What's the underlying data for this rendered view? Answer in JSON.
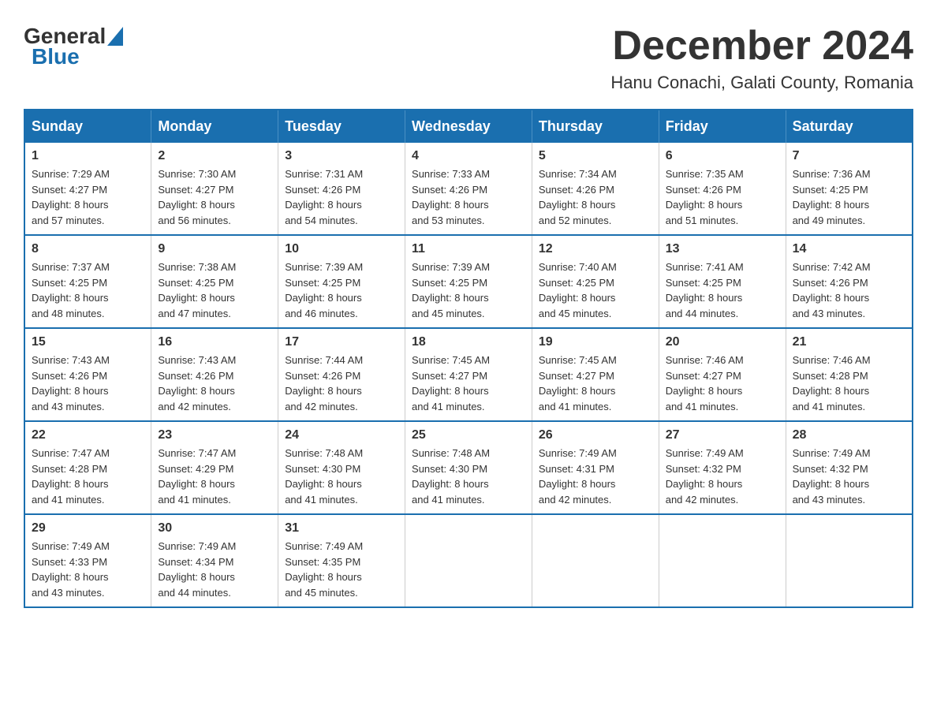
{
  "logo": {
    "general": "General",
    "blue": "Blue",
    "tagline": "Blue"
  },
  "title": {
    "month_year": "December 2024",
    "location": "Hanu Conachi, Galati County, Romania"
  },
  "weekdays": [
    "Sunday",
    "Monday",
    "Tuesday",
    "Wednesday",
    "Thursday",
    "Friday",
    "Saturday"
  ],
  "weeks": [
    [
      {
        "day": "1",
        "sunrise": "7:29 AM",
        "sunset": "4:27 PM",
        "daylight": "8 hours and 57 minutes."
      },
      {
        "day": "2",
        "sunrise": "7:30 AM",
        "sunset": "4:27 PM",
        "daylight": "8 hours and 56 minutes."
      },
      {
        "day": "3",
        "sunrise": "7:31 AM",
        "sunset": "4:26 PM",
        "daylight": "8 hours and 54 minutes."
      },
      {
        "day": "4",
        "sunrise": "7:33 AM",
        "sunset": "4:26 PM",
        "daylight": "8 hours and 53 minutes."
      },
      {
        "day": "5",
        "sunrise": "7:34 AM",
        "sunset": "4:26 PM",
        "daylight": "8 hours and 52 minutes."
      },
      {
        "day": "6",
        "sunrise": "7:35 AM",
        "sunset": "4:26 PM",
        "daylight": "8 hours and 51 minutes."
      },
      {
        "day": "7",
        "sunrise": "7:36 AM",
        "sunset": "4:25 PM",
        "daylight": "8 hours and 49 minutes."
      }
    ],
    [
      {
        "day": "8",
        "sunrise": "7:37 AM",
        "sunset": "4:25 PM",
        "daylight": "8 hours and 48 minutes."
      },
      {
        "day": "9",
        "sunrise": "7:38 AM",
        "sunset": "4:25 PM",
        "daylight": "8 hours and 47 minutes."
      },
      {
        "day": "10",
        "sunrise": "7:39 AM",
        "sunset": "4:25 PM",
        "daylight": "8 hours and 46 minutes."
      },
      {
        "day": "11",
        "sunrise": "7:39 AM",
        "sunset": "4:25 PM",
        "daylight": "8 hours and 45 minutes."
      },
      {
        "day": "12",
        "sunrise": "7:40 AM",
        "sunset": "4:25 PM",
        "daylight": "8 hours and 45 minutes."
      },
      {
        "day": "13",
        "sunrise": "7:41 AM",
        "sunset": "4:25 PM",
        "daylight": "8 hours and 44 minutes."
      },
      {
        "day": "14",
        "sunrise": "7:42 AM",
        "sunset": "4:26 PM",
        "daylight": "8 hours and 43 minutes."
      }
    ],
    [
      {
        "day": "15",
        "sunrise": "7:43 AM",
        "sunset": "4:26 PM",
        "daylight": "8 hours and 43 minutes."
      },
      {
        "day": "16",
        "sunrise": "7:43 AM",
        "sunset": "4:26 PM",
        "daylight": "8 hours and 42 minutes."
      },
      {
        "day": "17",
        "sunrise": "7:44 AM",
        "sunset": "4:26 PM",
        "daylight": "8 hours and 42 minutes."
      },
      {
        "day": "18",
        "sunrise": "7:45 AM",
        "sunset": "4:27 PM",
        "daylight": "8 hours and 41 minutes."
      },
      {
        "day": "19",
        "sunrise": "7:45 AM",
        "sunset": "4:27 PM",
        "daylight": "8 hours and 41 minutes."
      },
      {
        "day": "20",
        "sunrise": "7:46 AM",
        "sunset": "4:27 PM",
        "daylight": "8 hours and 41 minutes."
      },
      {
        "day": "21",
        "sunrise": "7:46 AM",
        "sunset": "4:28 PM",
        "daylight": "8 hours and 41 minutes."
      }
    ],
    [
      {
        "day": "22",
        "sunrise": "7:47 AM",
        "sunset": "4:28 PM",
        "daylight": "8 hours and 41 minutes."
      },
      {
        "day": "23",
        "sunrise": "7:47 AM",
        "sunset": "4:29 PM",
        "daylight": "8 hours and 41 minutes."
      },
      {
        "day": "24",
        "sunrise": "7:48 AM",
        "sunset": "4:30 PM",
        "daylight": "8 hours and 41 minutes."
      },
      {
        "day": "25",
        "sunrise": "7:48 AM",
        "sunset": "4:30 PM",
        "daylight": "8 hours and 41 minutes."
      },
      {
        "day": "26",
        "sunrise": "7:49 AM",
        "sunset": "4:31 PM",
        "daylight": "8 hours and 42 minutes."
      },
      {
        "day": "27",
        "sunrise": "7:49 AM",
        "sunset": "4:32 PM",
        "daylight": "8 hours and 42 minutes."
      },
      {
        "day": "28",
        "sunrise": "7:49 AM",
        "sunset": "4:32 PM",
        "daylight": "8 hours and 43 minutes."
      }
    ],
    [
      {
        "day": "29",
        "sunrise": "7:49 AM",
        "sunset": "4:33 PM",
        "daylight": "8 hours and 43 minutes."
      },
      {
        "day": "30",
        "sunrise": "7:49 AM",
        "sunset": "4:34 PM",
        "daylight": "8 hours and 44 minutes."
      },
      {
        "day": "31",
        "sunrise": "7:49 AM",
        "sunset": "4:35 PM",
        "daylight": "8 hours and 45 minutes."
      },
      null,
      null,
      null,
      null
    ]
  ],
  "labels": {
    "sunrise": "Sunrise:",
    "sunset": "Sunset:",
    "daylight": "Daylight:"
  }
}
